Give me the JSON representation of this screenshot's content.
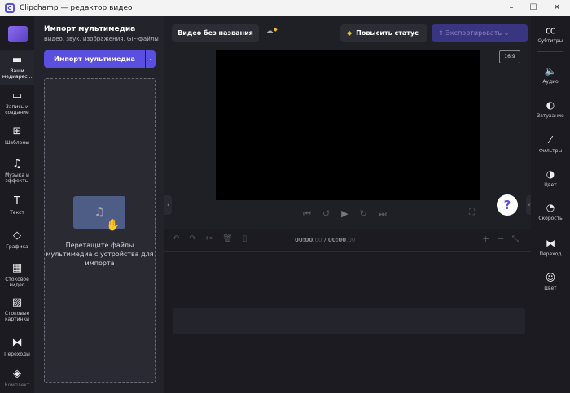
{
  "window": {
    "title": "Clipchamp — редактор видео",
    "minimize": "–",
    "maximize": "☐",
    "close": "✕"
  },
  "leftnav": [
    {
      "label": "Ваши медиарес...",
      "icon": "folder-icon",
      "glyph": "▬"
    },
    {
      "label": "Запись и создание",
      "icon": "video-camera-icon",
      "glyph": "▭"
    },
    {
      "label": "Шаблоны",
      "icon": "templates-icon",
      "glyph": "⊞"
    },
    {
      "label": "Музыка и эффекты",
      "icon": "music-icon",
      "glyph": "♫"
    },
    {
      "label": "Текст",
      "icon": "text-icon",
      "glyph": "T"
    },
    {
      "label": "Графика",
      "icon": "shapes-icon",
      "glyph": "◇"
    },
    {
      "label": "Стоковое видео",
      "icon": "film-icon",
      "glyph": "▦"
    },
    {
      "label": "Стоковые картинки",
      "icon": "image-icon",
      "glyph": "▨"
    },
    {
      "label": "Переходы",
      "icon": "transition-icon",
      "glyph": "⧓"
    },
    {
      "label": "Комплект",
      "icon": "brand-kit-icon",
      "glyph": "◈"
    }
  ],
  "panel": {
    "title": "Импорт мультимедиа",
    "subtitle": "Видео, звук, изображения, GIF-файлы",
    "import_button": "Импорт мультимедиа",
    "dropdown": "⌄",
    "drop_text": "Перетащите файлы мультимедиа с устройства для импорта"
  },
  "topbar": {
    "video_title": "Видео без названия",
    "upgrade": "Повысить статус",
    "export": "Экспортировать"
  },
  "preview": {
    "aspect_ratio": "16:9",
    "help": "?"
  },
  "timeline": {
    "current": "00:00",
    "current_ms": ".00",
    "separator": " / ",
    "total": "00:00",
    "total_ms": ".00"
  },
  "rightnav": [
    {
      "label": "Субтитры",
      "icon": "captions-icon",
      "glyph": "㏄"
    },
    {
      "label": "Аудио",
      "icon": "speaker-icon",
      "glyph": "🔈"
    },
    {
      "label": "Затухание",
      "icon": "fade-icon",
      "glyph": "◐"
    },
    {
      "label": "Фильтры",
      "icon": "magic-wand-icon",
      "glyph": "⁄"
    },
    {
      "label": "Цвет",
      "icon": "contrast-icon",
      "glyph": "◑"
    },
    {
      "label": "Скорость",
      "icon": "speedometer-icon",
      "glyph": "◔"
    },
    {
      "label": "Переход",
      "icon": "transition-icon",
      "glyph": "⧓"
    },
    {
      "label": "Цвет",
      "icon": "palette-icon",
      "glyph": "☺"
    }
  ],
  "colors": {
    "accent": "#5b4fe0",
    "background": "#1f1f26",
    "premium": "#f0c030"
  }
}
